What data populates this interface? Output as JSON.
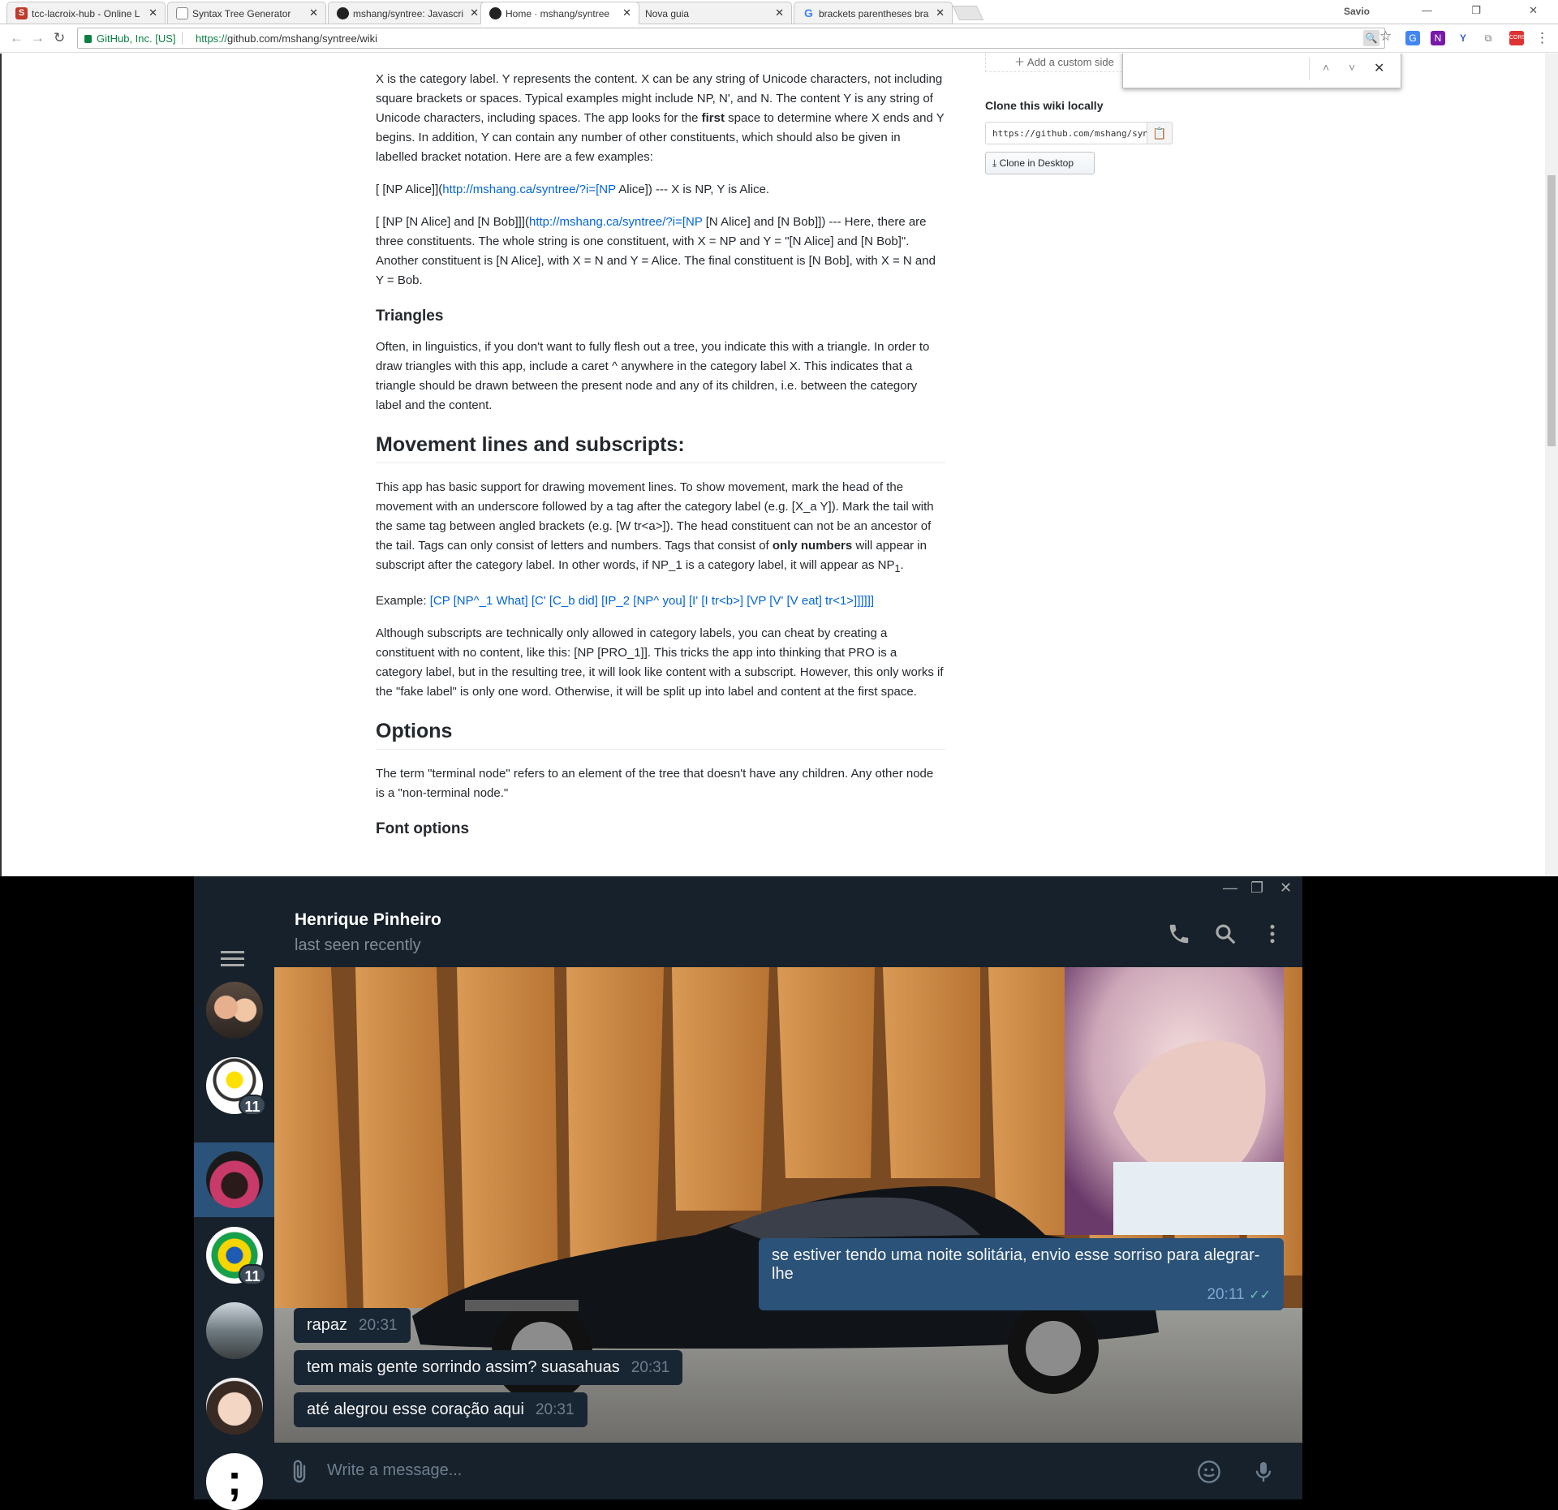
{
  "browser": {
    "tabs": [
      {
        "label": "tcc-lacroix-hub - Online L",
        "favicon": "scribd-icon"
      },
      {
        "label": "Syntax Tree Generator",
        "favicon": "page-icon"
      },
      {
        "label": "mshang/syntree: Javascri",
        "favicon": "github-icon"
      },
      {
        "label": "Home · mshang/syntree",
        "favicon": "github-icon",
        "active": true
      },
      {
        "label": "Nova guia",
        "favicon": "none"
      },
      {
        "label": "brackets parentheses bra",
        "favicon": "google-icon"
      }
    ],
    "profile_name": "Savio",
    "ev_label": "GitHub, Inc. [US]",
    "url_scheme": "https://",
    "url_rest": "github.com/mshang/syntree/wiki"
  },
  "article": {
    "p1": "X is the category label. Y represents the content. X can be any string of Unicode characters, not including square brackets or spaces. Typical examples might include NP, N', and N. The content Y is any string of Unicode characters, including spaces. The app looks for the ",
    "p1_bold": "first",
    "p1_end": " space to determine where X ends and Y begins. In addition, Y can contain any number of other constituents, which should also be given in labelled bracket notation. Here are a few examples:",
    "ex1_pre": "[ [NP Alice]](",
    "ex1_link": "http://mshang.ca/syntree/?i=[NP",
    "ex1_post": " Alice]) --- X is NP, Y is Alice.",
    "ex2_pre": "[ [NP [N Alice] and [N Bob]]](",
    "ex2_link": "http://mshang.ca/syntree/?i=[NP",
    "ex2_post": " [N Alice] and [N Bob]]) --- Here, there are three constituents. The whole string is one constituent, with X = NP and Y = \"[N Alice] and [N Bob]\". Another constituent is [N Alice], with X = N and Y = Alice. The final constituent is [N Bob], with X = N and Y = Bob.",
    "h_triangles": "Triangles",
    "p_triangles": "Often, in linguistics, if you don't want to fully flesh out a tree, you indicate this with a triangle. In order to draw triangles with this app, include a caret ^ anywhere in the category label X. This indicates that a triangle should be drawn between the present node and any of its children, i.e. between the category label and the content.",
    "h_movement": "Movement lines and subscripts:",
    "p_movement": "This app has basic support for drawing movement lines. To show movement, mark the head of the movement with an underscore followed by a tag after the category label (e.g. [X_a Y]). Mark the tail with the same tag between angled brackets (e.g. [W tr<a>]). The head constituent can not be an ancestor of the tail. Tags can only consist of letters and numbers. Tags that consist of ",
    "p_movement_bold": "only numbers",
    "p_movement_end": " will appear in subscript after the category label. In other words, if NP_1 is a category label, it will appear as NP",
    "p_movement_sub": "1",
    "p_movement_dot": ".",
    "example_label": "Example: ",
    "example_link": "[CP [NP^_1 What] [C' [C_b did] [IP_2 [NP^ you] [I' [I tr<b>] [VP [V' [V eat] tr<1>]]]]]]",
    "p_subscripts": "Although subscripts are technically only allowed in category labels, you can cheat by creating a constituent with no content, like this: [NP [PRO_1]]. This tricks the app into thinking that PRO is a category label, but in the resulting tree, it will look like content with a subscript. However, this only works if the \"fake label\" is only one word. Otherwise, it will be split up into label and content at the first space.",
    "h_options": "Options",
    "p_options": "The term \"terminal node\" refers to an element of the tree that doesn't have any children. Any other node is a \"non-terminal node.\"",
    "h_font": "Font options"
  },
  "sidebar": {
    "custom_sidebar": "Add a custom side",
    "clone_header": "Clone this wiki locally",
    "clone_url": "https://github.com/mshang/syntree.wiki.git",
    "clone_desktop": "Clone in Desktop"
  },
  "telegram": {
    "contact_name": "Henrique Pinheiro",
    "contact_status": "last seen recently",
    "badges": [
      "11",
      "11"
    ],
    "messages_in": [
      {
        "text": "rapaz",
        "time": "20:31"
      },
      {
        "text": "tem mais gente sorrindo assim? suasahuas",
        "time": "20:31"
      },
      {
        "text": "até alegrou esse coração aqui",
        "time": "20:31"
      }
    ],
    "message_out": {
      "text": "se estiver tendo uma noite solitária, envio esse sorriso para alegrar-lhe",
      "time": "20:11"
    },
    "composer_placeholder": "Write a message..."
  },
  "colors": {
    "accent_telegram": "#2b5278",
    "link": "#0366d6",
    "ev_green": "#0b8043"
  }
}
